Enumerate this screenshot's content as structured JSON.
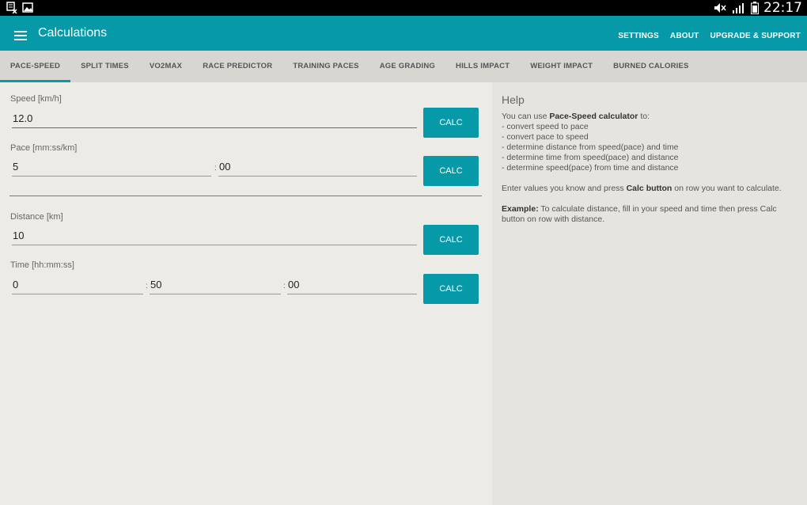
{
  "status": {
    "time": "22:17"
  },
  "appbar": {
    "title": "Calculations",
    "actions": [
      "SETTINGS",
      "ABOUT",
      "UPGRADE & SUPPORT"
    ]
  },
  "tabs": [
    "PACE-SPEED",
    "SPLIT TIMES",
    "VO2MAX",
    "RACE PREDICTOR",
    "TRAINING PACES",
    "AGE GRADING",
    "HILLS IMPACT",
    "WEIGHT IMPACT",
    "BURNED CALORIES"
  ],
  "form": {
    "speed": {
      "label": "Speed [km/h]",
      "value": "12.0"
    },
    "pace": {
      "label": "Pace [mm:ss/km]",
      "min": "5",
      "sec": "00"
    },
    "distance": {
      "label": "Distance [km]",
      "value": "10"
    },
    "time": {
      "label": "Time [hh:mm:ss]",
      "hh": "0",
      "mm": "50",
      "ss": "00"
    },
    "calc_label": "CALC",
    "colon": ":"
  },
  "help": {
    "title": "Help",
    "intro_pre": "You can use ",
    "intro_bold": "Pace-Speed calculator",
    "intro_post": " to:",
    "items": [
      "- convert speed to pace",
      "- convert pace to speed",
      "- determine distance from speed(pace) and time",
      "- determine time from speed(pace) and distance",
      "- determine speed(pace) from time and distance"
    ],
    "enter_pre": "Enter values you know and press ",
    "enter_bold": "Calc button",
    "enter_post": " on row you want to calculate.",
    "example_bold": "Example:",
    "example_text": " To calculate distance, fill in your speed and time then press Calc button on row with distance."
  },
  "colors": {
    "accent": "#0699a8",
    "error": "#e53935"
  }
}
